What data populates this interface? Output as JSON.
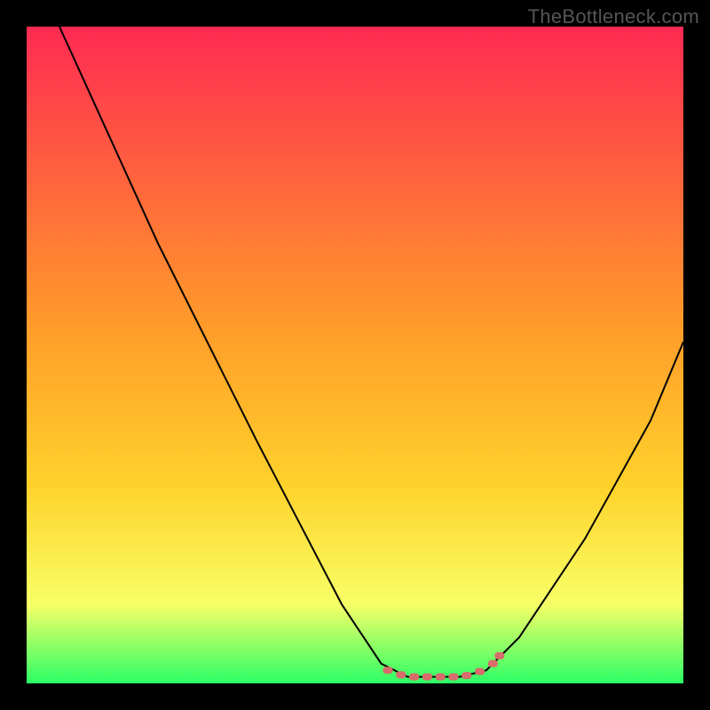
{
  "watermark": "TheBottleneck.com",
  "colors": {
    "black": "#000000",
    "curve": "#000000",
    "marker": "#d86b6b",
    "gradient_top": "#ff2a52",
    "gradient_mid": "#ffd22b",
    "gradient_low": "#f7ff66",
    "gradient_bottom": "#2cff66"
  },
  "chart_data": {
    "type": "line",
    "title": "",
    "xlabel": "",
    "ylabel": "",
    "xlim": [
      0,
      100
    ],
    "ylim": [
      0,
      100
    ],
    "grid": false,
    "legend": false,
    "background_gradient": {
      "stops": [
        {
          "offset": 0.0,
          "color": "#ff2a52"
        },
        {
          "offset": 0.45,
          "color": "#ff9a2a"
        },
        {
          "offset": 0.7,
          "color": "#ffd22b"
        },
        {
          "offset": 0.88,
          "color": "#f7ff66"
        },
        {
          "offset": 1.0,
          "color": "#2cff66"
        }
      ]
    },
    "series": [
      {
        "name": "curve",
        "color": "#000000",
        "points": [
          {
            "x": 5,
            "y": 100
          },
          {
            "x": 20,
            "y": 67
          },
          {
            "x": 35,
            "y": 37
          },
          {
            "x": 48,
            "y": 12
          },
          {
            "x": 54,
            "y": 3
          },
          {
            "x": 58,
            "y": 1
          },
          {
            "x": 62,
            "y": 1
          },
          {
            "x": 66,
            "y": 1
          },
          {
            "x": 70,
            "y": 2
          },
          {
            "x": 75,
            "y": 7
          },
          {
            "x": 85,
            "y": 22
          },
          {
            "x": 95,
            "y": 40
          },
          {
            "x": 100,
            "y": 52
          }
        ]
      }
    ],
    "markers": {
      "name": "bottom-highlight",
      "color": "#d86b6b",
      "points": [
        {
          "x": 55,
          "y": 2.0
        },
        {
          "x": 57,
          "y": 1.3
        },
        {
          "x": 59,
          "y": 1.0
        },
        {
          "x": 61,
          "y": 1.0
        },
        {
          "x": 63,
          "y": 1.0
        },
        {
          "x": 65,
          "y": 1.0
        },
        {
          "x": 67,
          "y": 1.2
        },
        {
          "x": 69,
          "y": 1.8
        },
        {
          "x": 71,
          "y": 3.0
        },
        {
          "x": 72,
          "y": 4.2
        }
      ]
    }
  }
}
